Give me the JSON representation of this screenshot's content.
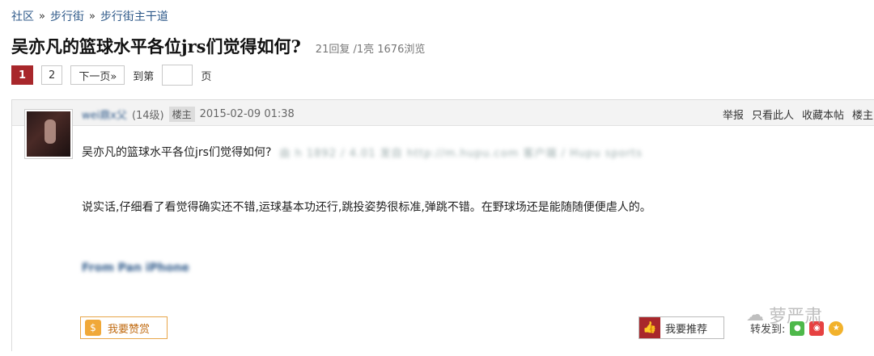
{
  "breadcrumb": {
    "items": [
      "社区",
      "步行街",
      "步行街主干道"
    ],
    "separator": "»"
  },
  "thread": {
    "title": "吴亦凡的篮球水平各位jrs们觉得如何?",
    "stats": "21回复 /1亮  1676浏览"
  },
  "pager": {
    "pages": [
      "1",
      "2"
    ],
    "current": "1",
    "next_label": "下一页»",
    "goto_label": "到第",
    "page_suffix": "页"
  },
  "post": {
    "username": "wei鼎x父",
    "level": "(14级)",
    "badge": "楼主",
    "timestamp": "2015-02-09 01:38",
    "actions": [
      "举报",
      "只看此人",
      "收藏本帖",
      "楼主"
    ],
    "quote_title": "吴亦凡的篮球水平各位jrs们觉得如何?",
    "quote_blurred": "由 h 1892 / 4.01 发自 http://m.hupu.com 客户端 / Hupu sports",
    "content": "说实话,仔细看了看觉得确实还不错,运球基本功还行,跳投姿势很标准,弹跳不错。在野球场还是能随随便便虐人的。",
    "signature": "From Pan iPhone"
  },
  "buttons": {
    "reward": "我要赞赏",
    "recommend": "我要推荐",
    "share_label": "转发到:"
  },
  "icons": {
    "coin": "coin-icon",
    "thumb": "thumbs-up-icon",
    "wechat": "wechat-icon",
    "weibo": "weibo-icon",
    "qzone": "qzone-icon"
  },
  "watermark": {
    "text": "萝严肃"
  },
  "colors": {
    "link": "#2f5a8a",
    "accent": "#a8272b",
    "reward": "#e8a64a"
  }
}
